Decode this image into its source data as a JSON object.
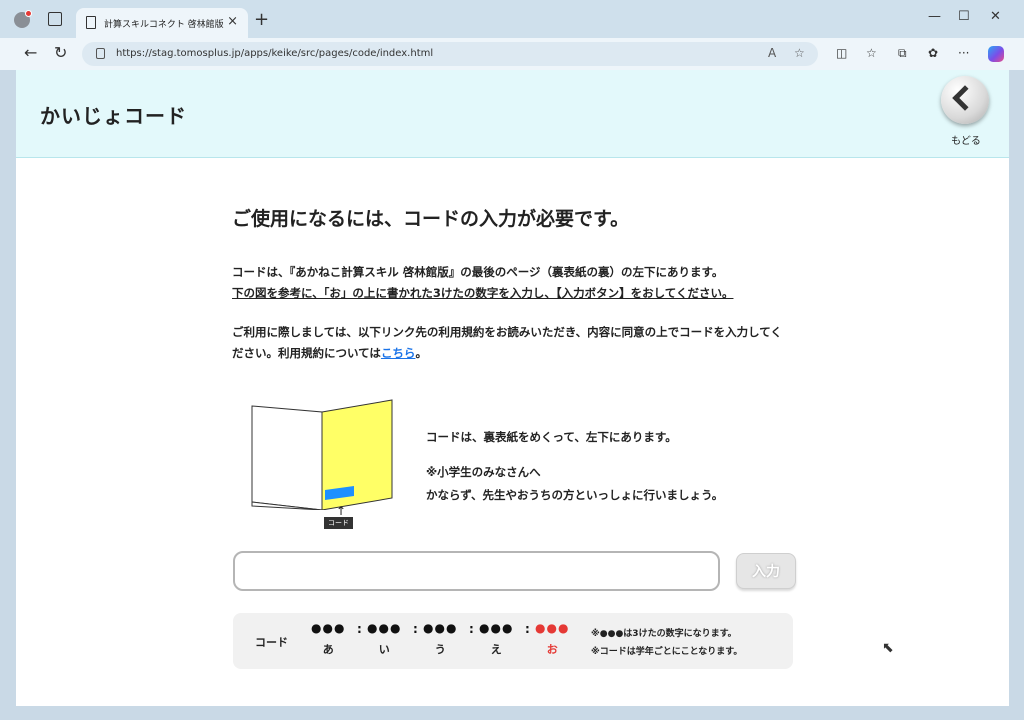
{
  "browser": {
    "tab_title": "計算スキルコネクト 啓林館版",
    "tab_close": "×",
    "new_tab": "+",
    "url": "https://stag.tomosplus.jp/apps/keike/src/pages/code/index.html",
    "read_aloud": "A̅",
    "minimize": "—",
    "maximize": "☐",
    "close": "✕",
    "back": "←",
    "refresh": "↻",
    "more": "···"
  },
  "header": {
    "title": "かいじょコード",
    "back_label": "もどる"
  },
  "main": {
    "heading": "ご使用になるには、コードの入力が必要です。",
    "para1_line1": "コードは、『あかねこ計算スキル 啓林館版』の最後のページ（裏表紙の裏）の左下にあります。",
    "para1_line2": "下の図を参考に、「お」の上に書かれた3けたの数字を入力し、【入力ボタン】をおしてください。",
    "para2_text": "ご利用に際しましては、以下リンク先の利用規約をお読みいただき、内容に同意の上でコードを入力してください。利用規約については",
    "para2_link": "こちら",
    "para2_end": "。"
  },
  "illustration": {
    "code_tag": "コード",
    "arrow": "↑",
    "note1": "コードは、裏表紙をめくって、左下にあります。",
    "note2": "※小学生のみなさんへ",
    "note3": "かならず、先生やおうちの方といっしょに行いましょう。"
  },
  "form": {
    "input_value": "",
    "input_placeholder": "",
    "enter_label": "入力"
  },
  "code_format": {
    "label": "コード",
    "segments": [
      {
        "dots": "●●●",
        "kana": "あ"
      },
      {
        "dots": "●●●",
        "kana": "い"
      },
      {
        "dots": "●●●",
        "kana": "う"
      },
      {
        "dots": "●●●",
        "kana": "え"
      },
      {
        "dots": "●●●",
        "kana": "お"
      }
    ],
    "separator": ":",
    "note1": "※●●●は3けたの数字になります。",
    "note2": "※コードは学年ごとにことなります。"
  },
  "colors": {
    "header_bg": "#e3f9fb",
    "link": "#1a73e8",
    "highlight_red": "#e53935",
    "booklet_yellow": "#ffff66",
    "code_blue": "#1e90ff"
  }
}
